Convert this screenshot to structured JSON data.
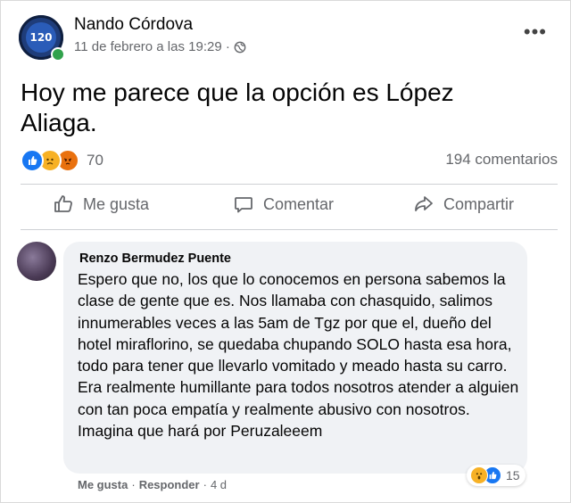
{
  "post": {
    "author": "Nando Córdova",
    "avatar_text": "120",
    "meta": "11 de febrero a las 19:29 ·",
    "text": "Hoy me parece que la opción es López Aliaga.",
    "reaction_count": "70",
    "reactions": [
      "like-icon",
      "sad-icon",
      "angry-icon"
    ],
    "comments_count": "194 comentarios"
  },
  "actions": {
    "like_label": "Me gusta",
    "comment_label": "Comentar",
    "share_label": "Compartir"
  },
  "comment": {
    "author": "Renzo Bermudez Puente",
    "text": "Espero que no, los que lo conocemos en persona sabemos la clase de gente que es. Nos llamaba con chasquido, salimos innumerables veces a las 5am de Tgz por que el, dueño del hotel miraflorino, se quedaba chupando SOLO hasta esa hora, todo para tener que llevarlo vomitado y meado hasta su carro. Era realmente humillante para todos nosotros atender a alguien con tan poca empatía y realmente abusivo con nosotros. Imagina que hará por Peruzaleeem",
    "reaction_count": "15",
    "reactions": [
      "wow-icon",
      "like-icon"
    ],
    "like_label": "Me gusta",
    "separator": "·",
    "reply_label": "Responder",
    "separator2": "·",
    "time": "4 d"
  },
  "colors": {
    "accent": "#1877f2",
    "text_secondary": "#65676b",
    "bubble": "#f0f2f5"
  }
}
